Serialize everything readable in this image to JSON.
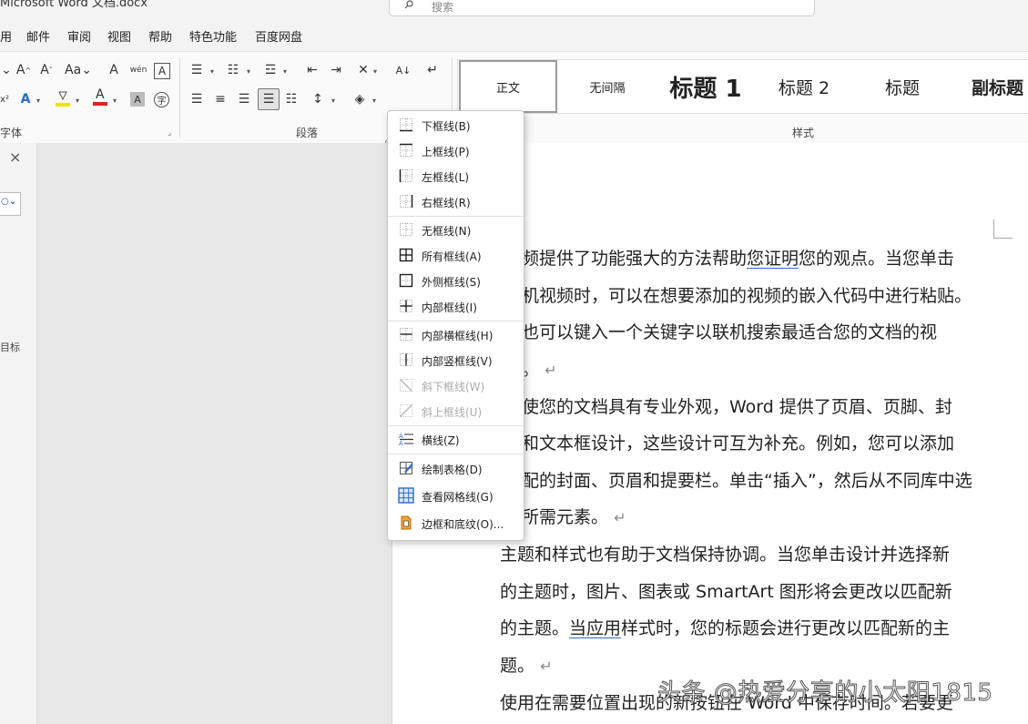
{
  "window": {
    "title": "Microsoft Word 文档.docx",
    "search_placeholder": "搜索"
  },
  "menu": [
    "用",
    "邮件",
    "审阅",
    "视图",
    "帮助",
    "特色功能",
    "百度网盘"
  ],
  "ribbon": {
    "group_font_label": "字体",
    "group_paragraph_label": "段落",
    "group_styles_label": "样式",
    "styles": [
      "正文",
      "无间隔",
      "标题 1",
      "标题 2",
      "标题",
      "副标题"
    ]
  },
  "nav_pane": {
    "close": "×",
    "label": "目标"
  },
  "borders_menu": {
    "items": [
      {
        "label": "下框线(B)",
        "icon": "bottom-border-icon",
        "enabled": true
      },
      {
        "label": "上框线(P)",
        "icon": "top-border-icon",
        "enabled": true
      },
      {
        "label": "左框线(L)",
        "icon": "left-border-icon",
        "enabled": true
      },
      {
        "label": "右框线(R)",
        "icon": "right-border-icon",
        "enabled": true
      },
      {
        "label": "无框线(N)",
        "icon": "no-border-icon",
        "enabled": true
      },
      {
        "label": "所有框线(A)",
        "icon": "all-borders-icon",
        "enabled": true
      },
      {
        "label": "外侧框线(S)",
        "icon": "outside-borders-icon",
        "enabled": true
      },
      {
        "label": "内部框线(I)",
        "icon": "inside-borders-icon",
        "enabled": true
      },
      {
        "label": "内部横框线(H)",
        "icon": "inside-horizontal-border-icon",
        "enabled": true
      },
      {
        "label": "内部竖框线(V)",
        "icon": "inside-vertical-border-icon",
        "enabled": true
      },
      {
        "label": "斜下框线(W)",
        "icon": "diagonal-down-border-icon",
        "enabled": false
      },
      {
        "label": "斜上框线(U)",
        "icon": "diagonal-up-border-icon",
        "enabled": false
      },
      {
        "label": "横线(Z)",
        "icon": "horizontal-line-icon",
        "enabled": true
      },
      {
        "label": "绘制表格(D)",
        "icon": "draw-table-icon",
        "enabled": true
      },
      {
        "label": "查看网格线(G)",
        "icon": "view-gridlines-icon",
        "enabled": true
      },
      {
        "label": "边框和底纹(O)...",
        "icon": "borders-and-shading-icon",
        "enabled": true
      }
    ]
  },
  "document": {
    "paragraph_mark": "↵",
    "lines": [
      "频提供了功能强大的方法帮助您证明您的观点。当您单击",
      "机视频时，可以在想要添加的视频的嵌入代码中进行粘贴。",
      "也可以键入一个关键字以联机搜索最适合您的文档的视",
      "。",
      "使您的文档具有专业外观，Word 提供了页眉、页脚、封",
      "和文本框设计，这些设计可互为补充。例如，您可以添加",
      "配的封面、页眉和提要栏。单击“插入”，然后从不同库中选",
      "所需元素。",
      "主题和样式也有助于文档保持协调。当您单击设计并选择新",
      "的主题时，图片、图表或 SmartArt 图形将会更改以匹配新",
      "的主题。当应用样式时，您的标题会进行更改以匹配新的主",
      "题。",
      "使用在需要位置出现的新按钮在 Word 中保存时间。若要更"
    ]
  },
  "watermark": "头条 @热爱分享的小太阳1815",
  "colors": {
    "highlight": "#f5e100",
    "font_color": "#e02020",
    "accent": "#2b6cc4"
  }
}
